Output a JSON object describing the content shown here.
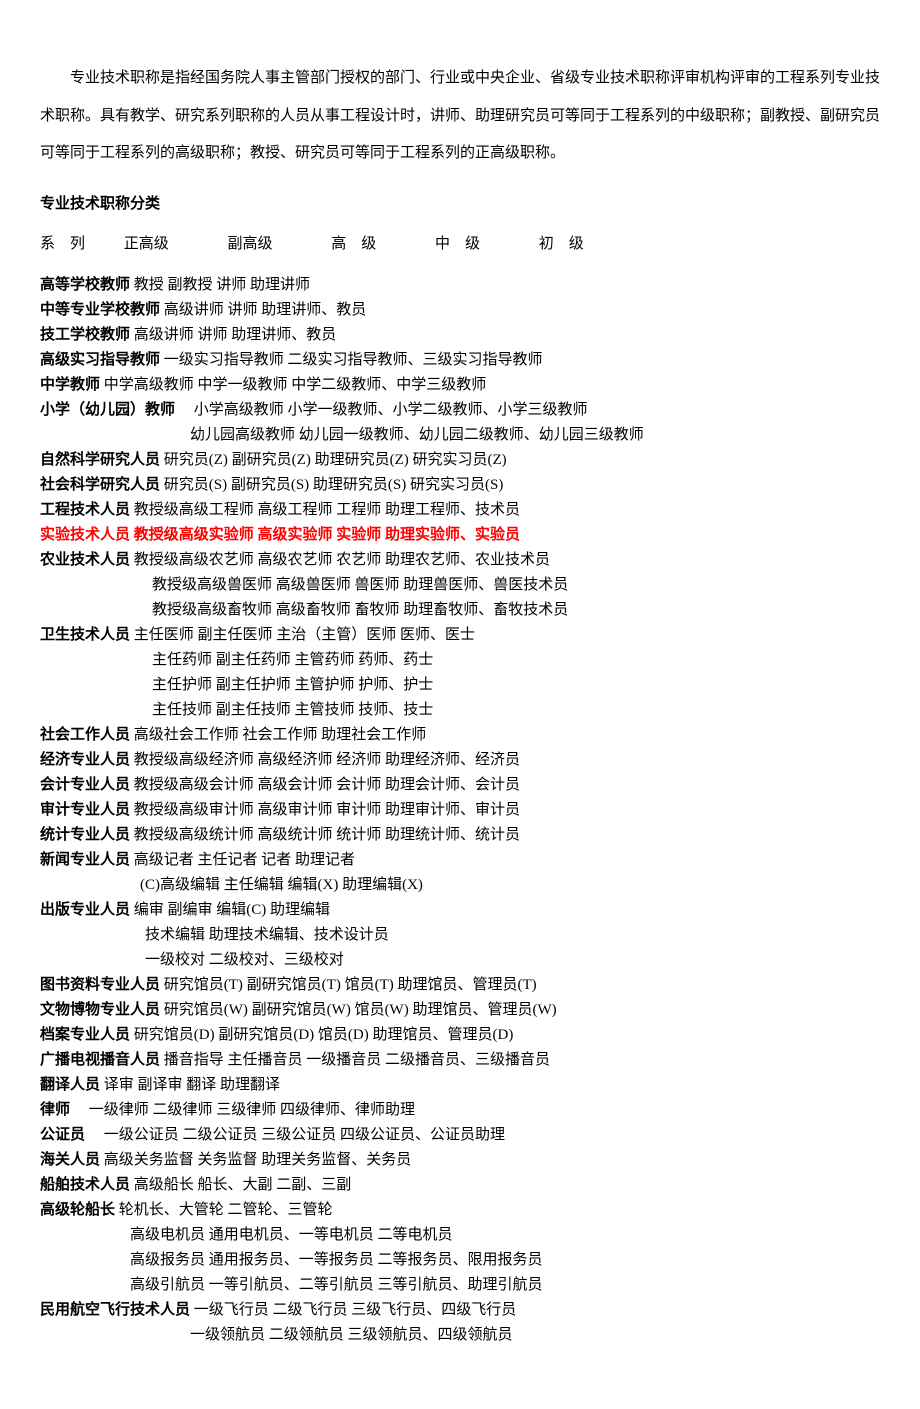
{
  "intro": "专业技术职称是指经国务院人事主管部门授权的部门、行业或中央企业、省级专业技术职称评审机构评审的工程系列专业技术职称。具有教学、研究系列职称的人员从事工程设计时，讲师、助理研究员可等同于工程系列的中级职称；副教授、副研究员可等同于工程系列的高级职称；教授、研究员可等同于工程系列的正高级职称。",
  "sectionTitle": "专业技术职称分类",
  "header": {
    "c1": "系　列",
    "c2": "正高级",
    "c3": "副高级",
    "c4": "高　级",
    "c5": "中　级",
    "c6": "初　级"
  },
  "rows": [
    {
      "bold": "高等学校教师",
      "rest": " 教授 副教授 讲师 助理讲师"
    },
    {
      "bold": "中等专业学校教师",
      "rest": " 高级讲师 讲师 助理讲师、教员"
    },
    {
      "bold": "技工学校教师",
      "rest": " 高级讲师 讲师 助理讲师、教员"
    },
    {
      "bold": "高级实习指导教师",
      "rest": " 一级实习指导教师 二级实习指导教师、三级实习指导教师"
    },
    {
      "bold": "中学教师",
      "rest": " 中学高级教师 中学一级教师 中学二级教师、中学三级教师"
    },
    {
      "bold": "小学（幼儿园）教师",
      "rest": "　 小学高级教师 小学一级教师、小学二级教师、小学三级教师"
    },
    {
      "cls": "indent2",
      "rest": "幼儿园高级教师 幼儿园一级教师、幼儿园二级教师、幼儿园三级教师"
    },
    {
      "bold": "自然科学研究人员",
      "rest": " 研究员(Z) 副研究员(Z) 助理研究员(Z) 研究实习员(Z)"
    },
    {
      "bold": "社会科学研究人员",
      "rest": " 研究员(S) 副研究员(S) 助理研究员(S) 研究实习员(S)"
    },
    {
      "bold": "工程技术人员",
      "rest": " 教授级高级工程师 高级工程师 工程师 助理工程师、技术员"
    },
    {
      "highlight": true,
      "bold": "实验技术人员",
      "rest": " 教授级高级实验师 高级实验师 实验师 助理实验师、实验员"
    },
    {
      "bold": "农业技术人员",
      "rest": " 教授级高级农艺师 高级农艺师 农艺师 助理农艺师、农业技术员"
    },
    {
      "cls": "indent1",
      "rest": "教授级高级兽医师 高级兽医师 兽医师 助理兽医师、兽医技术员"
    },
    {
      "cls": "indent1",
      "rest": "教授级高级畜牧师 高级畜牧师 畜牧师 助理畜牧师、畜牧技术员"
    },
    {
      "bold": "卫生技术人员",
      "rest": " 主任医师 副主任医师 主治（主管）医师 医师、医士"
    },
    {
      "cls": "indent1",
      "rest": "主任药师 副主任药师 主管药师 药师、药士"
    },
    {
      "cls": "indent1",
      "rest": "主任护师 副主任护师 主管护师 护师、护士"
    },
    {
      "cls": "indent1",
      "rest": "主任技师 副主任技师 主管技师 技师、技士"
    },
    {
      "bold": "社会工作人员",
      "rest": " 高级社会工作师 社会工作师 助理社会工作师"
    },
    {
      "bold": "经济专业人员",
      "rest": " 教授级高级经济师 高级经济师 经济师 助理经济师、经济员"
    },
    {
      "bold": "会计专业人员",
      "rest": " 教授级高级会计师 高级会计师 会计师 助理会计师、会计员"
    },
    {
      "bold": "审计专业人员",
      "rest": " 教授级高级审计师 高级审计师 审计师 助理审计师、审计员"
    },
    {
      "bold": "统计专业人员",
      "rest": " 教授级高级统计师 高级统计师 统计师 助理统计师、统计员"
    },
    {
      "bold": "新闻专业人员",
      "rest": " 高级记者 主任记者 记者 助理记者"
    },
    {
      "cls": "indent-news",
      "rest": "(C)高级编辑 主任编辑 编辑(X) 助理编辑(X)"
    },
    {
      "bold": "出版专业人员",
      "rest": " 编审 副编审 编辑(C) 助理编辑"
    },
    {
      "cls": "indent-pub",
      "rest": "技术编辑 助理技术编辑、技术设计员"
    },
    {
      "cls": "indent-pub",
      "rest": "一级校对 二级校对、三级校对"
    },
    {
      "bold": "图书资料专业人员",
      "rest": " 研究馆员(T) 副研究馆员(T) 馆员(T) 助理馆员、管理员(T)"
    },
    {
      "bold": "文物博物专业人员",
      "rest": " 研究馆员(W) 副研究馆员(W) 馆员(W) 助理馆员、管理员(W)"
    },
    {
      "bold": "档案专业人员",
      "rest": " 研究馆员(D) 副研究馆员(D) 馆员(D) 助理馆员、管理员(D)"
    },
    {
      "bold": "广播电视播音人员",
      "rest": " 播音指导 主任播音员 一级播音员 二级播音员、三级播音员"
    },
    {
      "bold": "翻译人员",
      "rest": " 译审 副译审 翻译 助理翻译"
    },
    {
      "bold": "律师",
      "rest": "　 一级律师 二级律师 三级律师 四级律师、律师助理"
    },
    {
      "bold": "公证员",
      "rest": "　 一级公证员 二级公证员 三级公证员 四级公证员、公证员助理"
    },
    {
      "bold": "海关人员",
      "rest": " 高级关务监督 关务监督 助理关务监督、关务员"
    },
    {
      "bold": "船舶技术人员",
      "rest": " 高级船长 船长、大副 二副、三副"
    },
    {
      "bold": "高级轮船长",
      "rest": " 轮机长、大管轮 二管轮、三管轮"
    },
    {
      "cls": "indent-ship",
      "rest": "高级电机员 通用电机员、一等电机员 二等电机员"
    },
    {
      "cls": "indent-ship",
      "rest": "高级报务员 通用报务员、一等报务员 二等报务员、限用报务员"
    },
    {
      "cls": "indent-ship",
      "rest": "高级引航员 一等引航员、二等引航员 三等引航员、助理引航员"
    },
    {
      "bold": "民用航空飞行技术人员",
      "rest": " 一级飞行员 二级飞行员 三级飞行员、四级飞行员"
    },
    {
      "cls": "indent-air",
      "rest": "一级领航员 二级领航员 三级领航员、四级领航员"
    }
  ]
}
